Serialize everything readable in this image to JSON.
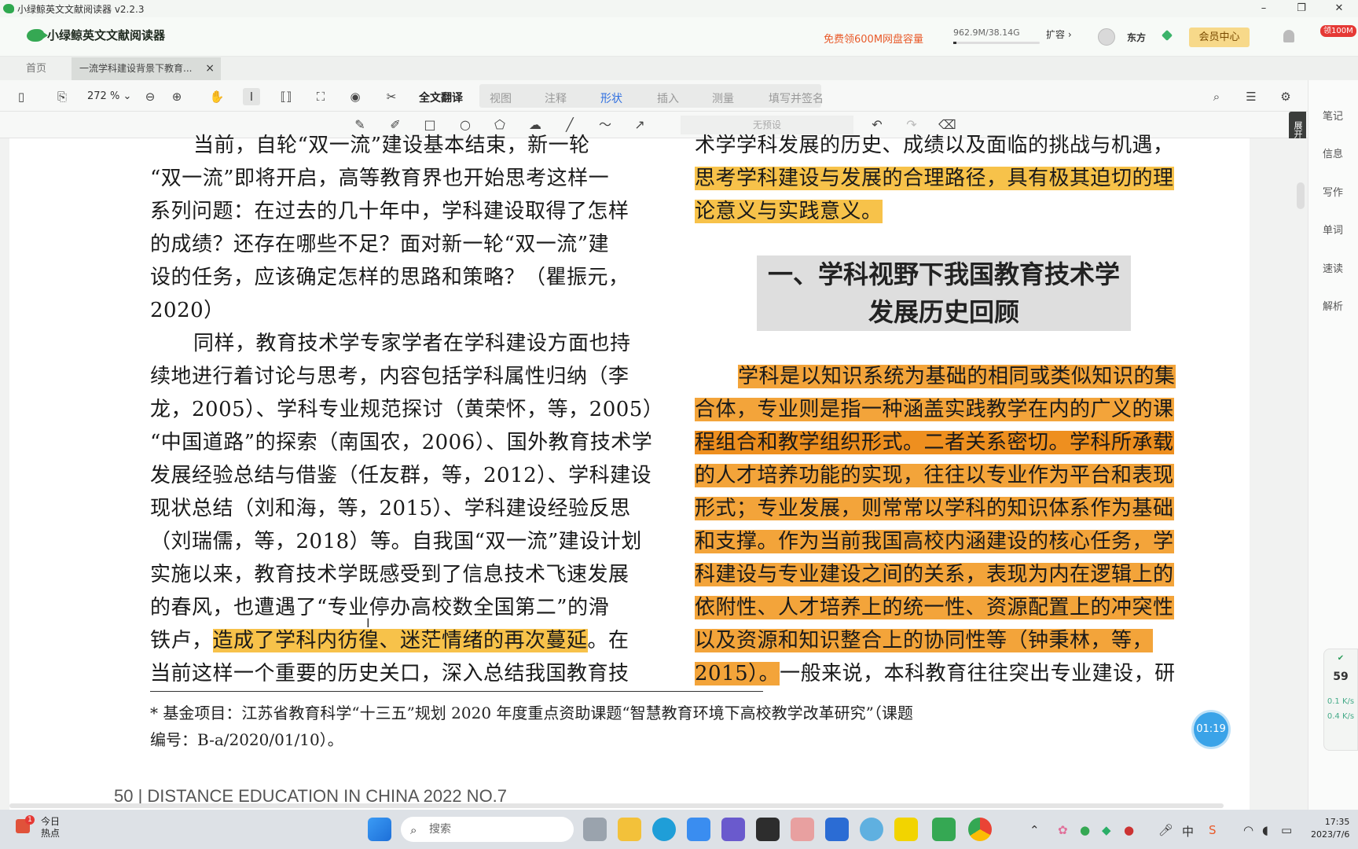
{
  "window": {
    "title": "小绿鲸英文文献阅读器 v2.2.3"
  },
  "header": {
    "brand": "小绿鲸英文文献阅读器",
    "promo": "免费领600M网盘容量",
    "storage": "962.9M/38.14G",
    "expand_label": "扩容 ›",
    "user_name": "东方",
    "member_center": "会员中心",
    "badge": "领100M"
  },
  "tabs": [
    {
      "label": "首页"
    },
    {
      "label": "一流学科建设背景下教育...",
      "close": "×"
    }
  ],
  "toolbar": {
    "zoom": "272 %",
    "full_translate": "全文翻译",
    "menus": [
      "视图",
      "注释",
      "形状",
      "插入",
      "测量",
      "填写并签名"
    ],
    "active_menu": "形状",
    "preset": "无预设"
  },
  "side_panel": {
    "expand_translate": "展开翻译",
    "items": [
      "笔记",
      "信息",
      "写作",
      "单词",
      "速读",
      "解析"
    ]
  },
  "document": {
    "left_column": [
      "当前，自轮“双一流”建设基本结束，新一轮",
      "“双一流”即将开启，高等教育界也开始思考这样一",
      "系列问题：在过去的几十年中，学科建设取得了怎样",
      "的成绩？还存在哪些不足？面对新一轮“双一流”建",
      "设的任务，应该确定怎样的思路和策略？（瞿振元，",
      "2020）",
      "同样，教育技术学专家学者在学科建设方面也持",
      "续地进行着讨论与思考，内容包括学科属性归纳（李",
      "龙，2005）、学科专业规范探讨（黄荣怀，等，2005）、",
      "“中国道路”的探索（南国农，2006）、国外教育技术学",
      "发展经验总结与借鉴（任友群，等，2012）、学科建设",
      "现状总结（刘和海，等，2015）、学科建设经验反思",
      "（刘瑞儒，等，2018）等。自我国“双一流”建设计划",
      "实施以来，教育技术学既感受到了信息技术飞速发展",
      "的春风，也遭遇了“专业停办高校数全国第二”的滑"
    ],
    "left_line16_a": "铁卢，",
    "left_line16_hl": "造成了学科内彷徨、迷茫情绪的再次蔓延",
    "left_line16_b": "。在",
    "left_line17": "当前这样一个重要的历史关口，深入总结我国教育技",
    "right_top": [
      "术学学科发展的历史、成绩以及面临的挑战与机遇，",
      "思考学科建设与发展的合理路径，具有极其迫切的理",
      "论意义与实践意义。"
    ],
    "section_title_1": "一、学科视野下我国教育技术学",
    "section_title_2": "发展历史回顾",
    "right_body": [
      "学科是以知识系统为基础的相同或类似知识的集",
      "合体，专业则是指一种涵盖实践教学在内的广义的课",
      "程组合和教学组织形式。二者关系密切。学科所承载",
      "的人才培养功能的实现，往往以专业作为平台和表现",
      "形式；专业发展，则常常以学科的知识体系作为基础",
      "和支撑。作为当前我国高校内涵建设的核心任务，学",
      "科建设与专业建设之间的关系，表现为内在逻辑上的",
      "依附性、人才培养上的统一性、资源配置上的冲突性",
      "以及资源和知识整合上的协同性等（钟秉林，等，"
    ],
    "right_last_hl": "2015）。",
    "right_last_rest": "一般来说，本科教育往往突出专业建设，研",
    "footnote_1": "* 基金项目：江苏省教育科学“十三五”规划 2020 年度重点资助课题“智慧教育环境下高校教学改革研究”（课题",
    "footnote_2": "编号：B-a/2020/01/10）。",
    "page_footer": "50 | DISTANCE EDUCATION IN CHINA 2022 NO.7"
  },
  "widgets": {
    "timer": "01:19",
    "net_percent": "59",
    "net_up": "0.1 K/s",
    "net_down": "0.4 K/s"
  },
  "taskbar": {
    "weather_title": "今日",
    "weather_sub": "热点",
    "weather_badge": "1",
    "search_placeholder": "搜索",
    "ime": "中",
    "time": "17:35",
    "date": "2023/7/6"
  }
}
